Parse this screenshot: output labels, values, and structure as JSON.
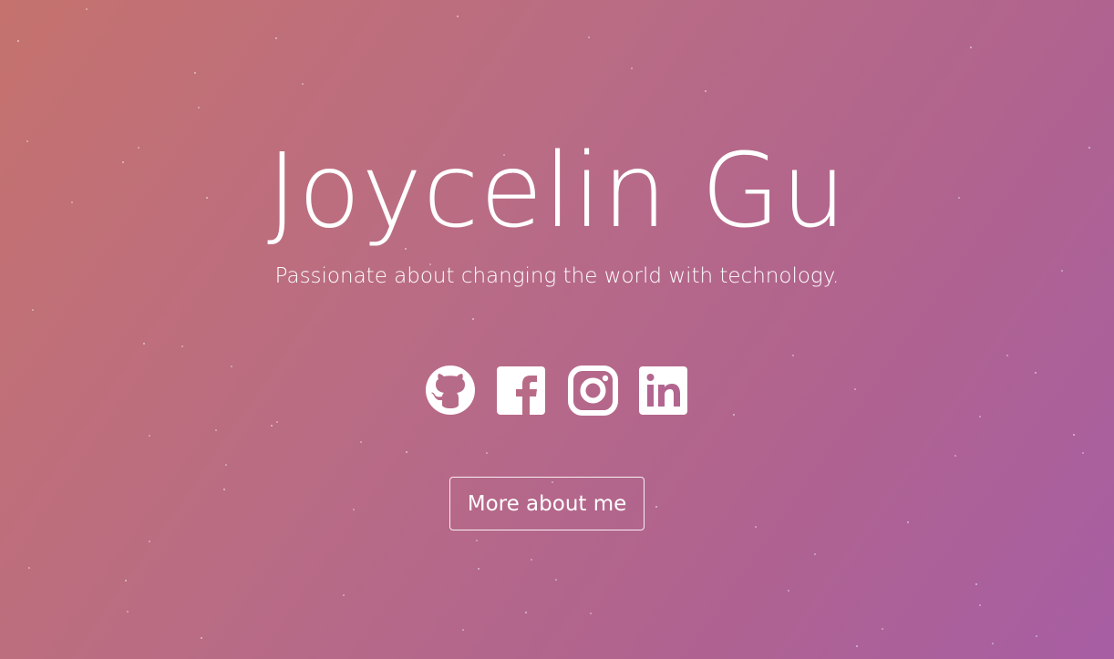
{
  "hero": {
    "name": "Joycelin Gu",
    "tagline": "Passionate about changing the world with technology.",
    "button_label": "More about me"
  },
  "socials": [
    {
      "name": "github",
      "icon": "github-icon"
    },
    {
      "name": "facebook",
      "icon": "facebook-icon"
    },
    {
      "name": "instagram",
      "icon": "instagram-icon"
    },
    {
      "name": "linkedin",
      "icon": "linkedin-icon"
    }
  ],
  "colors": {
    "gradient_start": "#c5726e",
    "gradient_end": "#a75ea3",
    "text": "#ffffff"
  }
}
